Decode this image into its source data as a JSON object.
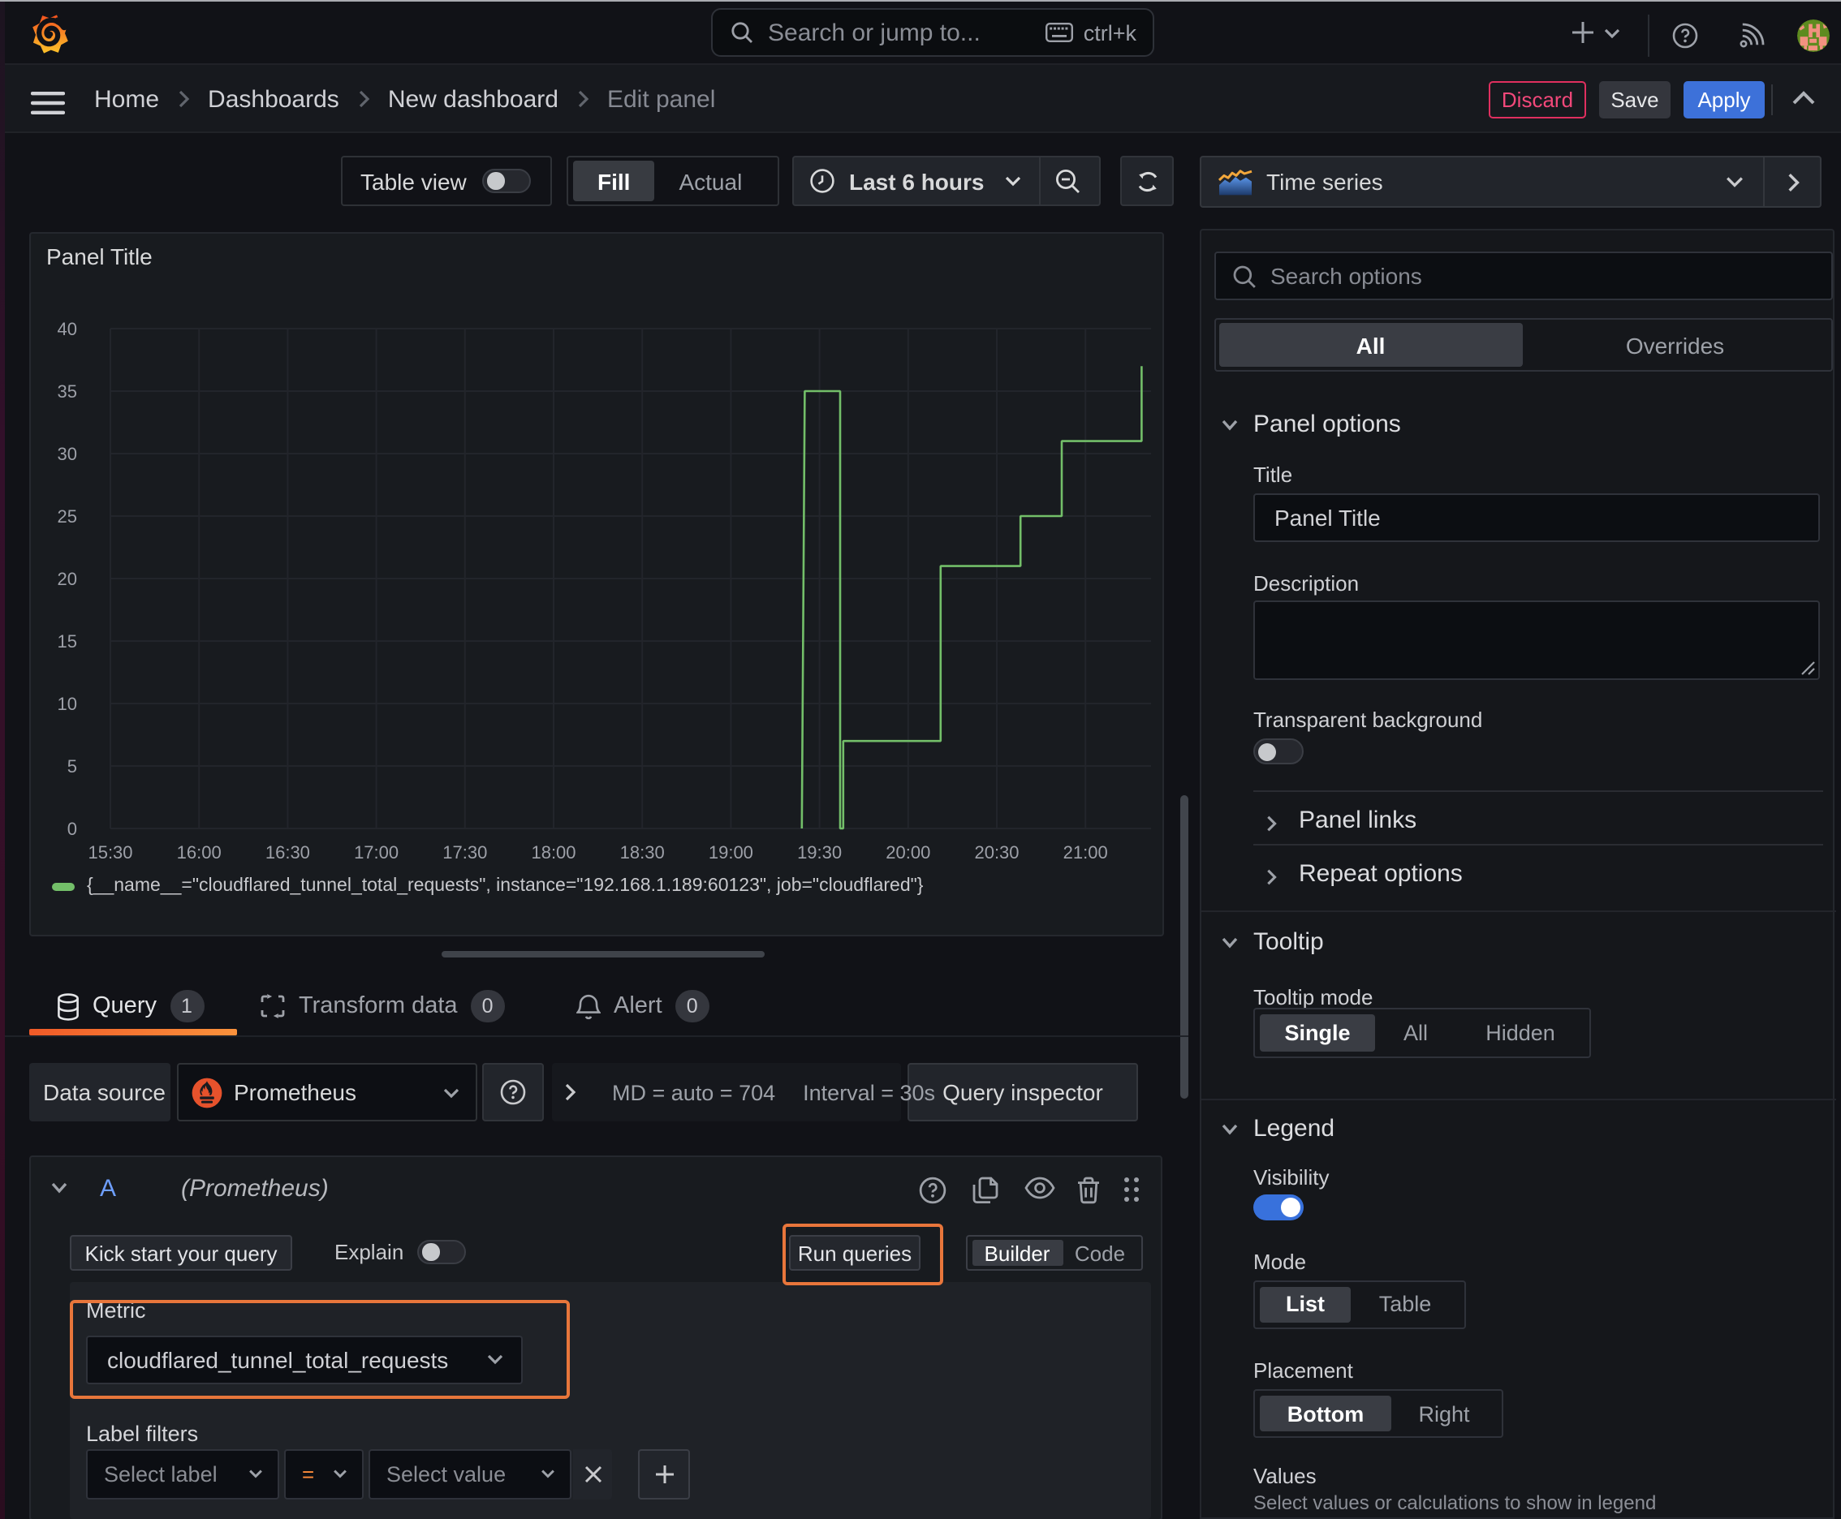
{
  "topbar": {
    "search_placeholder": "Search or jump to...",
    "shortcut": "ctrl+k",
    "icons": [
      "grafana-logo",
      "plus-icon",
      "chevron-down-icon",
      "help-circle-icon",
      "rss-icon",
      "avatar"
    ]
  },
  "breadcrumb": {
    "items": [
      "Home",
      "Dashboards",
      "New dashboard"
    ],
    "current": "Edit panel",
    "discard_label": "Discard",
    "save_label": "Save",
    "apply_label": "Apply"
  },
  "panel_controls": {
    "table_view_label": "Table view",
    "table_view_on": false,
    "fill_label": "Fill",
    "actual_label": "Actual",
    "fill_selected": "Fill",
    "time_range_label": "Last 6 hours"
  },
  "panel": {
    "title": "Panel Title",
    "legend_text": "{__name__=\"cloudflared_tunnel_total_requests\", instance=\"192.168.1.189:60123\", job=\"cloudflared\"}",
    "series_color": "#73bf69"
  },
  "chart_data": {
    "type": "line",
    "title": "Panel Title",
    "mode": "step-after",
    "xlabel": "",
    "ylabel": "",
    "ylim": [
      0,
      40
    ],
    "y_ticks": [
      0,
      5,
      10,
      15,
      20,
      25,
      30,
      35,
      40
    ],
    "x_ticks": [
      "15:30",
      "16:00",
      "16:30",
      "17:00",
      "17:30",
      "18:00",
      "18:30",
      "19:00",
      "19:30",
      "20:00",
      "20:30",
      "21:00"
    ],
    "x_range": [
      "15:30",
      "21:28"
    ],
    "grid": true,
    "legend_position": "bottom",
    "series": [
      {
        "name": "{__name__=\"cloudflared_tunnel_total_requests\", instance=\"192.168.1.189:60123\", job=\"cloudflared\"}",
        "color": "#73bf69",
        "points": [
          [
            "19:24",
            0
          ],
          [
            "19:25",
            35
          ],
          [
            "19:37",
            35
          ],
          [
            "19:37",
            0
          ],
          [
            "19:38",
            0
          ],
          [
            "19:38",
            7
          ],
          [
            "20:11",
            7
          ],
          [
            "20:11",
            21
          ],
          [
            "20:38",
            21
          ],
          [
            "20:38",
            25
          ],
          [
            "20:52",
            25
          ],
          [
            "20:52",
            31
          ],
          [
            "21:19",
            31
          ],
          [
            "21:19",
            37
          ]
        ]
      }
    ]
  },
  "tabs": {
    "query": {
      "label": "Query",
      "count": "1"
    },
    "transform": {
      "label": "Transform data",
      "count": "0"
    },
    "alert": {
      "label": "Alert",
      "count": "0"
    }
  },
  "datasource_row": {
    "label": "Data source",
    "value": "Prometheus",
    "stats_md": "MD = auto = 704",
    "stats_interval": "Interval = 30s",
    "inspector_label": "Query inspector"
  },
  "query_editor": {
    "ref_id": "A",
    "ds_hint": "(Prometheus)",
    "kickstart_label": "Kick start your query",
    "explain_label": "Explain",
    "explain_on": false,
    "run_label": "Run queries",
    "builder_label": "Builder",
    "code_label": "Code",
    "mode_selected": "Builder",
    "metric_label": "Metric",
    "metric_value": "cloudflared_tunnel_total_requests",
    "label_filters_label": "Label filters",
    "select_label_placeholder": "Select label",
    "operator": "=",
    "select_value_placeholder": "Select value"
  },
  "annotations": {
    "color": "#e8763b",
    "boxes": [
      "run-queries-button",
      "metric-selector"
    ]
  },
  "sidebar": {
    "visualization": "Time series",
    "search_placeholder": "Search options",
    "filter_tabs": {
      "all": "All",
      "overrides": "Overrides",
      "selected": "All"
    },
    "panel_options": {
      "heading": "Panel options",
      "title_label": "Title",
      "title_value": "Panel Title",
      "description_label": "Description",
      "description_value": "",
      "transparent_label": "Transparent background",
      "transparent_on": false
    },
    "collapsed_sections": {
      "panel_links": "Panel links",
      "repeat_options": "Repeat options"
    },
    "tooltip": {
      "heading": "Tooltip",
      "mode_label": "Tooltip mode",
      "options": [
        "Single",
        "All",
        "Hidden"
      ],
      "selected": "Single"
    },
    "legend": {
      "heading": "Legend",
      "visibility_label": "Visibility",
      "visibility_on": true,
      "mode_label": "Mode",
      "mode_options": [
        "List",
        "Table"
      ],
      "mode_selected": "List",
      "placement_label": "Placement",
      "placement_options": [
        "Bottom",
        "Right"
      ],
      "placement_selected": "Bottom",
      "values_label": "Values",
      "values_hint": "Select values or calculations to show in legend"
    }
  },
  "colors": {
    "accent_orange": "#ff780a",
    "tab_underline": "#f05a28",
    "primary_blue": "#3d71d9",
    "destructive_pink": "#e02f5f",
    "series_green": "#73bf69",
    "annotation_orange": "#e8763b",
    "panel_bg": "#181b1f",
    "page_bg": "#111217"
  }
}
